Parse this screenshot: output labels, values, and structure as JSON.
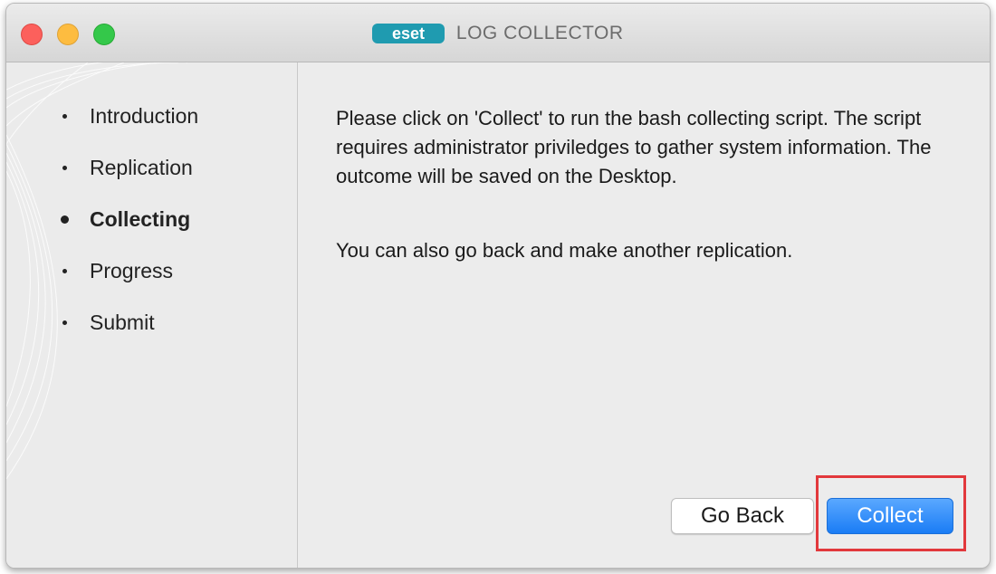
{
  "window": {
    "brand_logo_text": "eset",
    "title": "LOG COLLECTOR"
  },
  "sidebar": {
    "steps": [
      {
        "label": "Introduction",
        "active": false
      },
      {
        "label": "Replication",
        "active": false
      },
      {
        "label": "Collecting",
        "active": true
      },
      {
        "label": "Progress",
        "active": false
      },
      {
        "label": "Submit",
        "active": false
      }
    ]
  },
  "main": {
    "paragraph1": "Please click on 'Collect' to run the bash collecting script. The script requires administrator priviledges to gather system information. The outcome will be saved on the Desktop.",
    "paragraph2": "You can also go back and make another replication."
  },
  "buttons": {
    "back_label": "Go Back",
    "collect_label": "Collect"
  },
  "colors": {
    "accent": "#1a7cf5",
    "highlight": "#e2383c",
    "logo": "#1f9bb0"
  }
}
